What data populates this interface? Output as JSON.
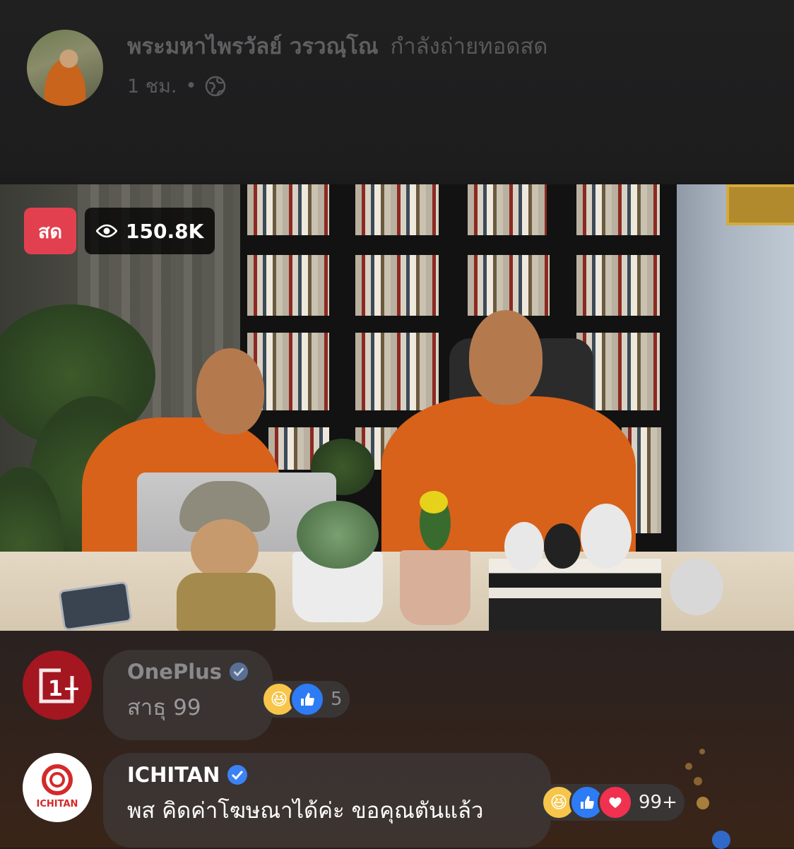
{
  "header": {
    "author": "พระมหาไพรวัลย์ วรวณฺโณ",
    "status": "กำลังถ่ายทอดสด",
    "time": "1 ชม.",
    "separator": "•",
    "privacy_icon": "globe-icon"
  },
  "video": {
    "live_label": "สด",
    "viewers": "150.8K",
    "viewer_icon": "eye-icon"
  },
  "comments": [
    {
      "author": "OnePlus",
      "verified": true,
      "text": "สาธุ 99",
      "reactions": [
        "haha",
        "like"
      ],
      "reaction_count": "5"
    },
    {
      "author": "ICHITAN",
      "verified": true,
      "text": "พส คิดค่าโฆษณาได้ค่ะ ขอคุณตันแล้ว",
      "reactions": [
        "haha",
        "like",
        "love"
      ],
      "reaction_count": "99+"
    }
  ],
  "avatars": {
    "oneplus_logo": "1+",
    "ichitan_logo": "ICHITAN"
  },
  "colors": {
    "live_red": "#e3404f",
    "verified_blue": "#3b82f6",
    "oneplus_red": "#a41620"
  }
}
